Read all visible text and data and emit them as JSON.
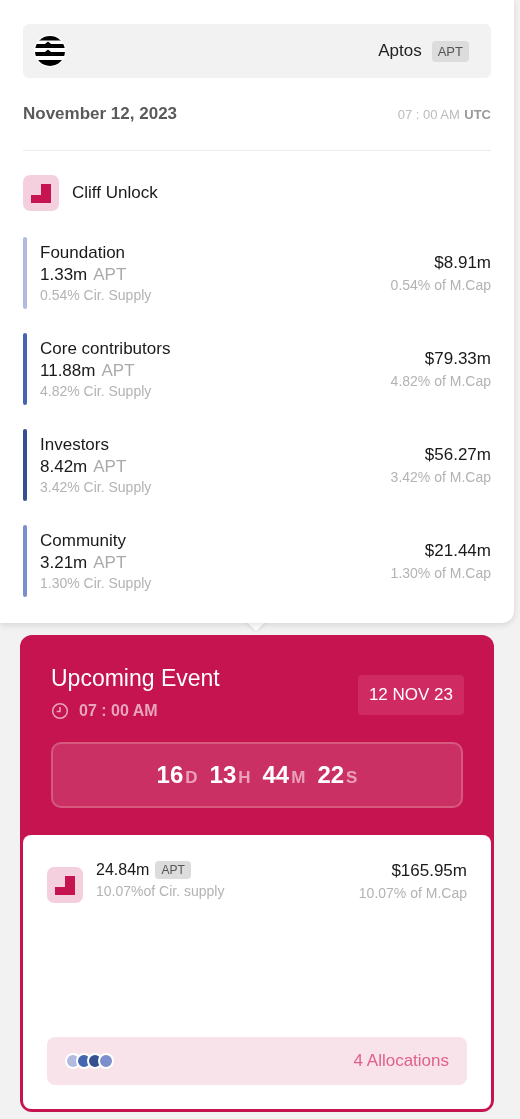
{
  "token": {
    "name": "Aptos",
    "symbol": "APT"
  },
  "date": "November 12, 2023",
  "time": "07 : 00 AM",
  "timezone": "UTC",
  "unlock_type": "Cliff Unlock",
  "allocations": [
    {
      "name": "Foundation",
      "amount": "1.33m",
      "unit": "APT",
      "supply": "0.54% Cir. Supply",
      "value": "$8.91m",
      "mcap": "0.54% of M.Cap",
      "color": "#b0bbdf"
    },
    {
      "name": "Core contributors",
      "amount": "11.88m",
      "unit": "APT",
      "supply": "4.82% Cir. Supply",
      "value": "$79.33m",
      "mcap": "4.82% of M.Cap",
      "color": "#4466b0"
    },
    {
      "name": "Investors",
      "amount": "8.42m",
      "unit": "APT",
      "supply": "3.42% Cir. Supply",
      "value": "$56.27m",
      "mcap": "3.42% of M.Cap",
      "color": "#34508f"
    },
    {
      "name": "Community",
      "amount": "3.21m",
      "unit": "APT",
      "supply": "1.30% Cir. Supply",
      "value": "$21.44m",
      "mcap": "1.30% of M.Cap",
      "color": "#7b8fcc"
    }
  ],
  "event": {
    "title": "Upcoming Event",
    "date_badge": "12 NOV 23",
    "time": "07 : 00 AM",
    "countdown": [
      {
        "value": "16",
        "unit": "D"
      },
      {
        "value": "13",
        "unit": "H"
      },
      {
        "value": "44",
        "unit": "M"
      },
      {
        "value": "22",
        "unit": "S"
      }
    ],
    "amount": "24.84m",
    "symbol": "APT",
    "supply": "10.07%of Cir. supply",
    "value": "$165.95m",
    "mcap": "10.07% of M.Cap",
    "allocations_label": "4 Allocations"
  }
}
